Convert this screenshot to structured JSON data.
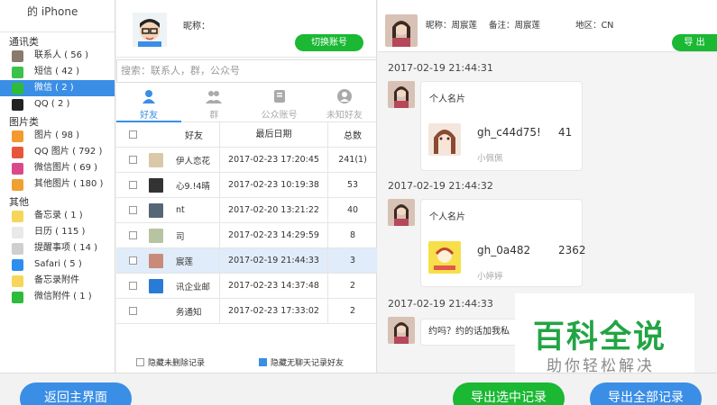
{
  "sidebar": {
    "device": "的 iPhone",
    "categories": [
      {
        "label": "通讯类",
        "items": [
          {
            "label": "联系人 ( 56 )",
            "icon": "contacts-icon",
            "color": "#8a7a6a"
          },
          {
            "label": "短信 ( 42 )",
            "icon": "message-icon",
            "color": "#3cc24b"
          },
          {
            "label": "微信 ( 2 )",
            "icon": "wechat-icon",
            "color": "#2dbb3a",
            "active": true
          },
          {
            "label": "QQ ( 2 )",
            "icon": "qq-icon",
            "color": "#222222"
          }
        ]
      },
      {
        "label": "图片类",
        "items": [
          {
            "label": "图片 ( 98 )",
            "icon": "photos-icon",
            "color": "#f29a2e"
          },
          {
            "label": "QQ 图片 ( 792 )",
            "icon": "qq-photos-icon",
            "color": "#e8563a"
          },
          {
            "label": "微信图片 ( 69 )",
            "icon": "wechat-photos-icon",
            "color": "#d84a8a"
          },
          {
            "label": "其他图片 ( 180 )",
            "icon": "other-photos-icon",
            "color": "#f0a030"
          }
        ]
      },
      {
        "label": "其他",
        "items": [
          {
            "label": "备忘录 ( 1 )",
            "icon": "notes-icon",
            "color": "#f6d65a"
          },
          {
            "label": "日历 ( 115 )",
            "icon": "calendar-icon",
            "color": "#e9e9e9"
          },
          {
            "label": "提醒事项 ( 14 )",
            "icon": "reminders-icon",
            "color": "#cfcfcf"
          },
          {
            "label": "Safari ( 5 )",
            "icon": "safari-icon",
            "color": "#2d8ef0"
          },
          {
            "label": "备忘录附件",
            "icon": "notes-attach-icon",
            "color": "#f6d65a"
          },
          {
            "label": "微信附件 ( 1 )",
            "icon": "wechat-attach-icon",
            "color": "#2dbb3a"
          }
        ]
      }
    ]
  },
  "profile": {
    "nick_label": "昵称：",
    "switch_label": "切换账号"
  },
  "search": {
    "placeholder": "搜索：联系人，群，公众号"
  },
  "tabs": [
    {
      "label": "好友",
      "icon": "friend-icon",
      "active": true
    },
    {
      "label": "群",
      "icon": "group-icon"
    },
    {
      "label": "公众账号",
      "icon": "official-account-icon"
    },
    {
      "label": "未知好友",
      "icon": "unknown-friend-icon"
    }
  ],
  "table": {
    "headers": {
      "name": "好友",
      "date": "最后日期",
      "count": "总数"
    },
    "rows": [
      {
        "name": "伊人恋花",
        "date": "2017-02-23 17:20:45",
        "count": "241(1)",
        "avatar_color": "#d9c9a8"
      },
      {
        "name": "心9.!4晴",
        "date": "2017-02-23 10:19:38",
        "count": "53",
        "avatar_color": "#333333"
      },
      {
        "name": "nt",
        "date": "2017-02-20 13:21:22",
        "count": "40",
        "avatar_color": "#556677"
      },
      {
        "name": "司",
        "date": "2017-02-23 14:29:59",
        "count": "8",
        "avatar_color": "#b7c4a2"
      },
      {
        "name": "宸莲",
        "date": "2017-02-19 21:44:33",
        "count": "3",
        "avatar_color": "#c98a7a",
        "selected": true
      },
      {
        "name": "讯企业邮",
        "date": "2017-02-23 14:37:48",
        "count": "2",
        "avatar_color": "#2a7ad8"
      },
      {
        "name": "务通知",
        "date": "2017-02-23 17:33:02",
        "count": "2",
        "avatar_color": ""
      }
    ]
  },
  "options": {
    "hide_deleted": "隐藏未删除记录",
    "hide_no_chat": "隐藏无聊天记录好友"
  },
  "chat": {
    "nickname": "昵称：周宸莲",
    "remark": "备注：周宸莲",
    "region": "地区：CN",
    "export_label": "导 出",
    "messages": [
      {
        "time": "2017-02-19 21:44:31",
        "type": "card",
        "title": "个人名片",
        "id": "gh_c44d75!",
        "num": "41",
        "sub": "小佩佩"
      },
      {
        "time": "2017-02-19 21:44:32",
        "type": "card",
        "title": "个人名片",
        "id": "gh_0a482",
        "num": "2362",
        "sub": "小婷婷"
      },
      {
        "time": "2017-02-19 21:44:33",
        "type": "text",
        "text": "约吗？约的话加我私"
      }
    ]
  },
  "watermark": {
    "line1": "百科全说",
    "line2": "助你轻松解决"
  },
  "footer": {
    "back": "返回主界面",
    "export_selected": "导出选中记录",
    "export_all": "导出全部记录"
  }
}
